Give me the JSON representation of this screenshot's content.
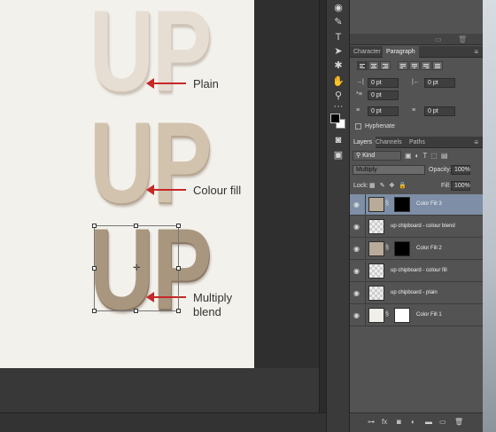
{
  "canvas": {
    "letters": "UP",
    "annotations": {
      "plain": "Plain",
      "colour_fill": "Colour fill",
      "multiply_line1": "Multiply",
      "multiply_line2": "blend"
    }
  },
  "tools": [
    {
      "name": "paint-bucket-icon",
      "glyph": "◉"
    },
    {
      "name": "pen-icon",
      "glyph": "✎"
    },
    {
      "name": "type-icon",
      "glyph": "T"
    },
    {
      "name": "path-select-icon",
      "glyph": "➤"
    },
    {
      "name": "custom-shape-icon",
      "glyph": "✱"
    },
    {
      "name": "hand-icon",
      "glyph": "✋"
    },
    {
      "name": "zoom-icon",
      "glyph": "⚲"
    },
    {
      "name": "ellipsis-icon",
      "glyph": "···"
    },
    {
      "name": "quick-mask-icon",
      "glyph": "◙"
    },
    {
      "name": "screen-mode-icon",
      "glyph": "▣"
    }
  ],
  "char_panel": {
    "tabs": [
      "Character",
      "Paragraph"
    ],
    "active_tab": "Paragraph",
    "fields": {
      "indent_left": "0 pt",
      "indent_right": "0 pt",
      "first_line": "0 pt",
      "space_before": "0 pt",
      "space_after": "0 pt"
    },
    "hyphenate_label": "Hyphenate"
  },
  "layers_panel": {
    "tabs": [
      "Layers",
      "Channels",
      "Paths"
    ],
    "active_tab": "Layers",
    "filter_kind": "Kind",
    "blend_mode": "Multiply",
    "opacity_label": "Opacity:",
    "opacity_value": "100%",
    "lock_label": "Lock:",
    "fill_label": "Fill:",
    "fill_value": "100%",
    "layers": [
      {
        "name": "Color Fill 3",
        "type": "fill",
        "swatch": "#b8ab99",
        "mask": "black",
        "selected": true
      },
      {
        "name": "up chipboard - colour blend",
        "type": "pixel",
        "selected": false
      },
      {
        "name": "Color Fill 2",
        "type": "fill",
        "swatch": "#b8ab99",
        "mask": "black",
        "selected": false
      },
      {
        "name": "up chipboard - colour fill",
        "type": "pixel",
        "selected": false
      },
      {
        "name": "up chipboard - plain",
        "type": "pixel",
        "selected": false
      },
      {
        "name": "Color Fill 1",
        "type": "fill",
        "swatch": "#f1efea",
        "mask": "white",
        "selected": false
      }
    ]
  },
  "colors": {
    "accent_arrow": "#c62828",
    "selected_layer": "#7d8ea6",
    "panel_bg": "#535353"
  }
}
